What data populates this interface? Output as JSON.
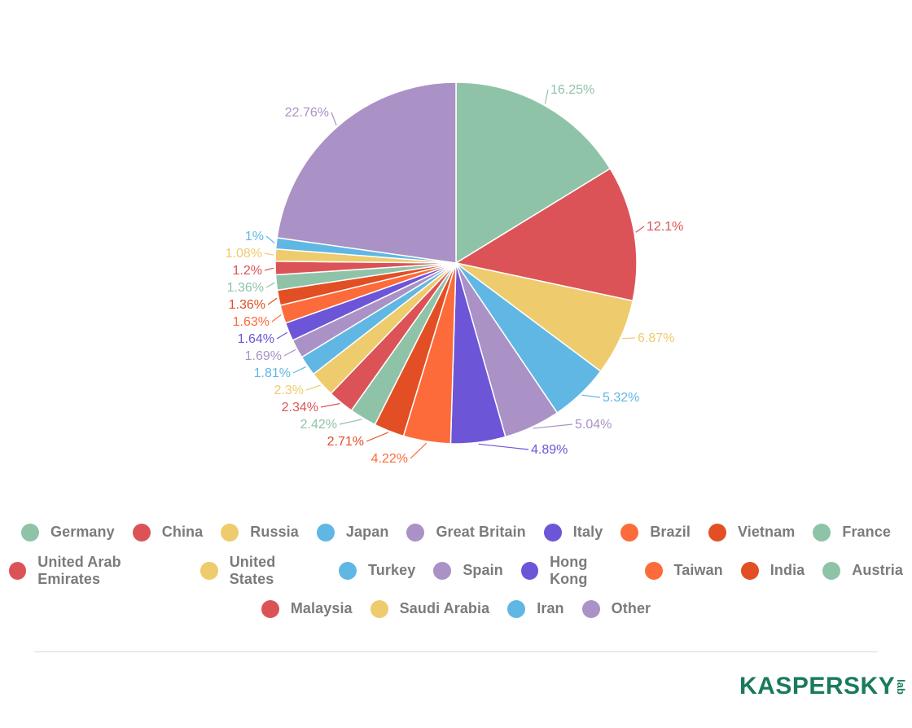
{
  "chart_data": {
    "type": "pie",
    "title": "",
    "start_angle_deg": 0,
    "direction": "clockwise",
    "label_format": "{value}%",
    "legend_position": "bottom",
    "slices": [
      {
        "label": "Germany",
        "value": 16.25,
        "display": "16.25%",
        "color": "#8fc3a8"
      },
      {
        "label": "China",
        "value": 12.1,
        "display": "12.1%",
        "color": "#dc5357"
      },
      {
        "label": "Russia",
        "value": 6.87,
        "display": "6.87%",
        "color": "#eecb6c"
      },
      {
        "label": "Japan",
        "value": 5.32,
        "display": "5.32%",
        "color": "#60b7e4"
      },
      {
        "label": "Great Britain",
        "value": 5.04,
        "display": "5.04%",
        "color": "#aa91c6"
      },
      {
        "label": "Italy",
        "value": 4.89,
        "display": "4.89%",
        "color": "#6d55d8"
      },
      {
        "label": "Brazil",
        "value": 4.22,
        "display": "4.22%",
        "color": "#fd6b3a"
      },
      {
        "label": "Vietnam",
        "value": 2.71,
        "display": "2.71%",
        "color": "#e24f24"
      },
      {
        "label": "France",
        "value": 2.42,
        "display": "2.42%",
        "color": "#8fc3a8"
      },
      {
        "label": "United Arab Emirates",
        "value": 2.34,
        "display": "2.34%",
        "color": "#dc5357"
      },
      {
        "label": "United States",
        "value": 2.3,
        "display": "2.3%",
        "color": "#eecb6c"
      },
      {
        "label": "Turkey",
        "value": 1.81,
        "display": "1.81%",
        "color": "#60b7e4"
      },
      {
        "label": "Spain",
        "value": 1.69,
        "display": "1.69%",
        "color": "#aa91c6"
      },
      {
        "label": "Hong Kong",
        "value": 1.64,
        "display": "1.64%",
        "color": "#6d55d8"
      },
      {
        "label": "Taiwan",
        "value": 1.63,
        "display": "1.63%",
        "color": "#fd6b3a"
      },
      {
        "label": "India",
        "value": 1.36,
        "display": "1.36%",
        "color": "#e24f24"
      },
      {
        "label": "Austria",
        "value": 1.36,
        "display": "1.36%",
        "color": "#8fc3a8"
      },
      {
        "label": "Malaysia",
        "value": 1.2,
        "display": "1.2%",
        "color": "#dc5357"
      },
      {
        "label": "Saudi Arabia",
        "value": 1.08,
        "display": "1.08%",
        "color": "#eecb6c"
      },
      {
        "label": "Iran",
        "value": 1,
        "display": "1%",
        "color": "#60b7e4"
      },
      {
        "label": "Other",
        "value": 22.76,
        "display": "22.76%",
        "color": "#aa91c6"
      }
    ]
  },
  "legend": {
    "rows": [
      [
        0,
        1,
        2,
        3,
        4,
        5,
        6,
        7,
        8
      ],
      [
        9,
        10,
        11,
        12,
        13,
        14,
        15,
        16
      ],
      [
        17,
        18,
        19,
        20
      ]
    ]
  },
  "branding": {
    "logo_text": "KASPERSKY",
    "logo_suffix": "lab"
  }
}
